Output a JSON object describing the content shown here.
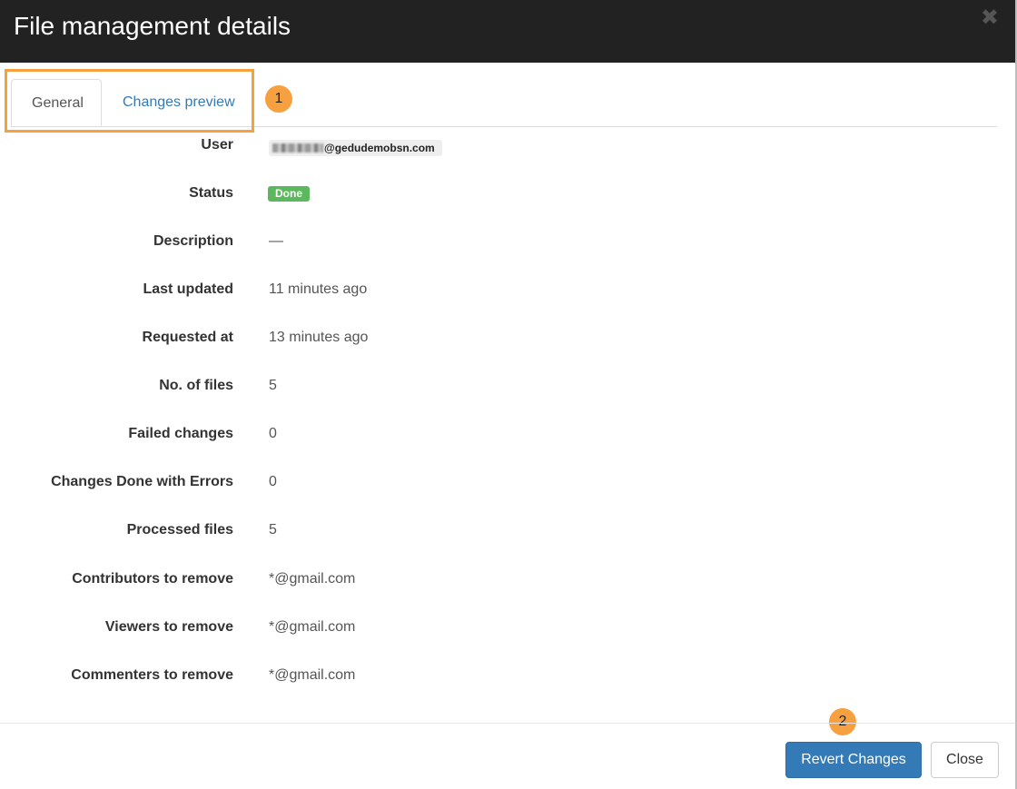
{
  "modal": {
    "title": "File management details",
    "close_icon": "close-icon"
  },
  "tabs": [
    {
      "label": "General",
      "active": true
    },
    {
      "label": "Changes preview",
      "active": false
    }
  ],
  "annotations": {
    "step1": "1",
    "step2": "2",
    "highlight_color": "#f7a03f"
  },
  "details": {
    "user": {
      "label": "User",
      "value": "@gedudemobsn.com"
    },
    "status": {
      "label": "Status",
      "value": "Done",
      "color": "#5cb85c"
    },
    "description": {
      "label": "Description",
      "value": "—"
    },
    "last_updated": {
      "label": "Last updated",
      "value": "11 minutes ago"
    },
    "requested_at": {
      "label": "Requested at",
      "value": "13 minutes ago"
    },
    "no_of_files": {
      "label": "No. of files",
      "value": "5"
    },
    "failed_changes": {
      "label": "Failed changes",
      "value": "0"
    },
    "changes_done_with_errors": {
      "label": "Changes Done with Errors",
      "value": "0"
    },
    "processed_files": {
      "label": "Processed files",
      "value": "5"
    },
    "contributors_to_remove": {
      "label": "Contributors to remove",
      "value": "*@gmail.com"
    },
    "viewers_to_remove": {
      "label": "Viewers to remove",
      "value": "*@gmail.com"
    },
    "commenters_to_remove": {
      "label": "Commenters to remove",
      "value": "*@gmail.com"
    }
  },
  "footer": {
    "revert_label": "Revert Changes",
    "close_label": "Close",
    "primary_color": "#337ab7"
  }
}
